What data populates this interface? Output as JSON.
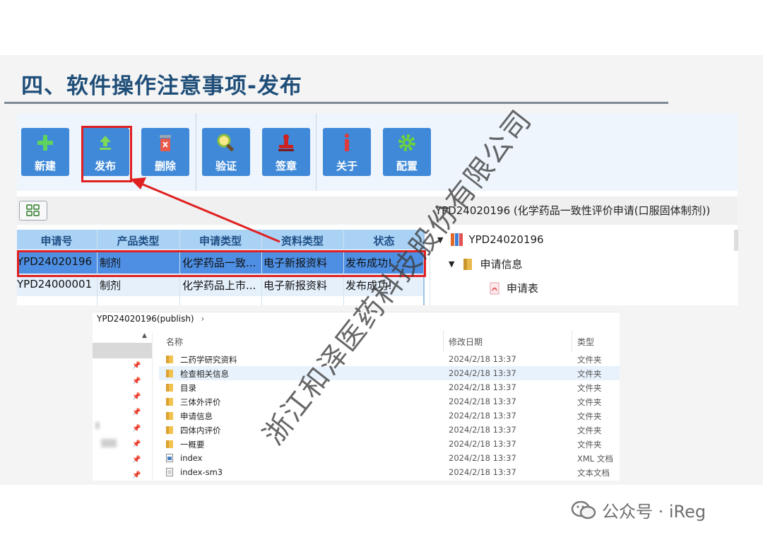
{
  "slide": {
    "title": "四、软件操作注意事项-发布"
  },
  "toolbar": {
    "buttons": [
      {
        "label": "新建",
        "icon": "plus-icon"
      },
      {
        "label": "发布",
        "icon": "upload-icon"
      },
      {
        "label": "删除",
        "icon": "trash-icon"
      },
      {
        "label": "验证",
        "icon": "magnifier-icon"
      },
      {
        "label": "签章",
        "icon": "stamp-icon"
      },
      {
        "label": "关于",
        "icon": "info-icon"
      },
      {
        "label": "配置",
        "icon": "gear-icon"
      }
    ]
  },
  "detail": {
    "title": "YPD24020196 (化学药品一致性评价申请(口服固体制剂))"
  },
  "grid": {
    "headers": [
      "申请号",
      "产品类型",
      "申请类型",
      "资料类型",
      "状态"
    ],
    "rows": [
      [
        "YPD24020196",
        "制剂",
        "化学药品一致...",
        "电子新报资料",
        "发布成功!"
      ],
      [
        "YPD24000001",
        "制剂",
        "化学药品上市...",
        "电子新报资料",
        "发布成功!"
      ]
    ]
  },
  "tree": {
    "root": "YPD24020196",
    "folder": "申请信息",
    "file": "申请表"
  },
  "explorer": {
    "breadcrumb": "YPD24020196(publish)",
    "breadcrumb_sep": "›",
    "columns": {
      "name": "名称",
      "date": "修改日期",
      "type": "类型"
    },
    "files": [
      {
        "name": "二药学研究资料",
        "date": "2024/2/18 13:37",
        "type": "文件夹",
        "icon": "folder-icon"
      },
      {
        "name": "检查相关信息",
        "date": "2024/2/18 13:37",
        "type": "文件夹",
        "icon": "folder-icon"
      },
      {
        "name": "目录",
        "date": "2024/2/18 13:37",
        "type": "文件夹",
        "icon": "folder-icon"
      },
      {
        "name": "三体外评价",
        "date": "2024/2/18 13:37",
        "type": "文件夹",
        "icon": "folder-icon"
      },
      {
        "name": "申请信息",
        "date": "2024/2/18 13:37",
        "type": "文件夹",
        "icon": "folder-icon"
      },
      {
        "name": "四体内评价",
        "date": "2024/2/18 13:37",
        "type": "文件夹",
        "icon": "folder-icon"
      },
      {
        "name": "一概要",
        "date": "2024/2/18 13:37",
        "type": "文件夹",
        "icon": "folder-icon"
      },
      {
        "name": "index",
        "date": "2024/2/18 13:37",
        "type": "XML 文档",
        "icon": "xml-file-icon"
      },
      {
        "name": "index-sm3",
        "date": "2024/2/18 13:37",
        "type": "文本文档",
        "icon": "text-file-icon"
      }
    ]
  },
  "watermark": "浙江和泽医药科技股份有限公司",
  "footer": {
    "text": "公众号 · iReg"
  },
  "colors": {
    "title": "#1f4e79",
    "button": "#3f89d8",
    "highlight": "#e02020",
    "selected_row": "#4e8fe3",
    "grid_header": "#a9d2f5"
  }
}
